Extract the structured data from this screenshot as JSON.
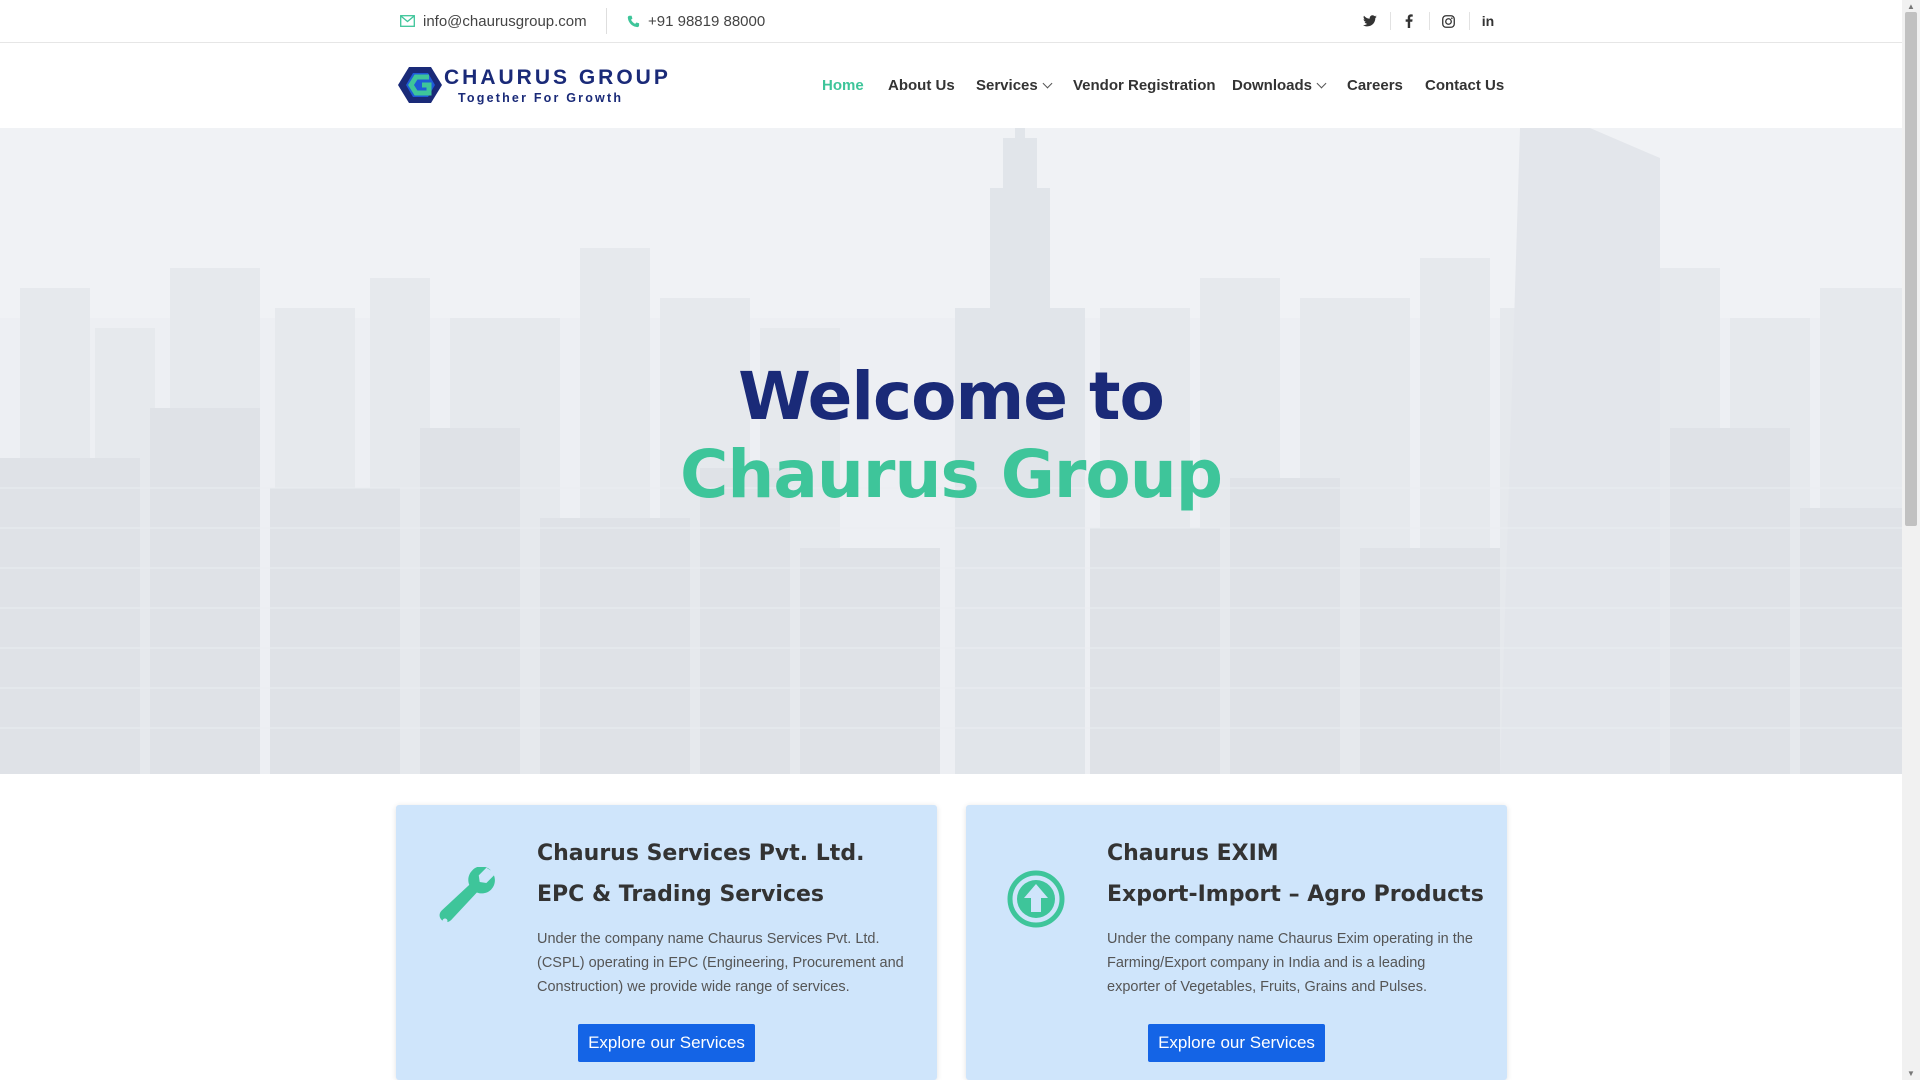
{
  "topbar": {
    "email": "info@chaurusgroup.com",
    "phone": "+91 98819 88000",
    "social": [
      {
        "name": "twitter-icon",
        "glyph": "𝕋"
      },
      {
        "name": "facebook-icon",
        "glyph": "f"
      },
      {
        "name": "instagram-icon",
        "glyph": "◎"
      },
      {
        "name": "linkedin-icon",
        "glyph": "in"
      }
    ]
  },
  "logo": {
    "name": "CHAURUS GROUP",
    "tagline": "Together For Growth"
  },
  "nav": {
    "items": [
      {
        "label": "Home",
        "active": true
      },
      {
        "label": "About Us"
      },
      {
        "label": "Services",
        "dropdown": true
      },
      {
        "label": "Vendor Registration"
      },
      {
        "label": "Downloads",
        "dropdown": true
      },
      {
        "label": "Careers"
      },
      {
        "label": "Contact Us"
      }
    ]
  },
  "hero": {
    "line1": "Welcome to",
    "line2": "Chaurus Group"
  },
  "cards": [
    {
      "title": "Chaurus Services Pvt. Ltd.",
      "subtitle": "EPC & Trading Services",
      "text": "Under the company name Chaurus Services Pvt. Ltd. (CSPL) operating in EPC (Engineering, Procurement and Construction) we provide wide range of services.",
      "button": "Explore our Services",
      "icon": "wrench-icon"
    },
    {
      "title": "Chaurus EXIM",
      "subtitle": "Export-Import – Agro Products",
      "text": "Under the company name Chaurus Exim operating in the Farming/Export company in India and is a leading exporter of Vegetables, Fruits, Grains and Pulses.",
      "button": "Explore our Services",
      "icon": "arrow-up-circle-icon"
    }
  ],
  "colors": {
    "brand_navy": "#1a2a78",
    "brand_green": "#3ec59a",
    "button_blue": "#1464e6",
    "card_bg": "#cfe5fb"
  }
}
